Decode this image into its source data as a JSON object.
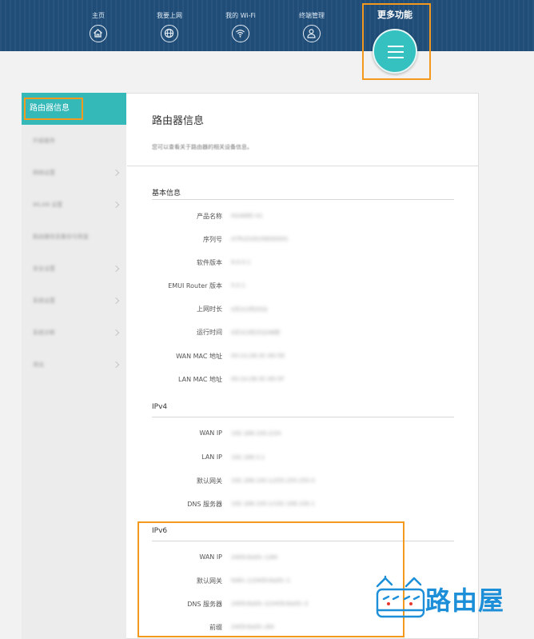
{
  "nav": {
    "items": [
      {
        "label": "主页",
        "icon": "home-icon"
      },
      {
        "label": "我要上网",
        "icon": "globe-icon"
      },
      {
        "label": "我的 Wi-Fi",
        "icon": "wifi-icon"
      },
      {
        "label": "终端管理",
        "icon": "user-icon"
      }
    ],
    "more_label": "更多功能",
    "more_icon": "menu-icon"
  },
  "sidebar": {
    "active": "路由器信息",
    "items": [
      "升级服务",
      "网络设置",
      "WLAN 设置",
      "路由器信息备份与恢复",
      "安全设置",
      "系统设置",
      "系统诊断",
      "退出"
    ]
  },
  "main": {
    "title": "路由器信息",
    "description": "您可以查看关于路由器的相关设备信息。",
    "sections": [
      {
        "title": "基本信息",
        "rows": [
          {
            "label": "产品名称",
            "value": "HUAWEI A1"
          },
          {
            "label": "序列号",
            "value": "A7PLD18109000001"
          },
          {
            "label": "软件版本",
            "value": "9.0.0.1"
          },
          {
            "label": "EMUI Router 版本",
            "value": "5.0.1"
          },
          {
            "label": "上网时长",
            "value": "0天3小时20分"
          },
          {
            "label": "运行时间",
            "value": "0天3小时25分46秒"
          },
          {
            "label": "WAN MAC 地址",
            "value": "00:1A:2B:3C:4D:5E"
          },
          {
            "label": "LAN MAC 地址",
            "value": "00:1A:2B:3C:4D:5F"
          }
        ]
      },
      {
        "title": "IPv4",
        "rows": [
          {
            "label": "WAN IP",
            "value": "192.168.100.2/24"
          },
          {
            "label": "LAN IP",
            "value": "192.168.3.1"
          },
          {
            "label": "默认网关",
            "value": "192.168.100.1/255.255.255.0"
          },
          {
            "label": "DNS 服务器",
            "value": "192.168.100.1/192.168.100.1"
          }
        ]
      },
      {
        "title": "IPv6",
        "rows": [
          {
            "label": "WAN IP",
            "value": "2409:8a00::1/64"
          },
          {
            "label": "默认网关",
            "value": "fe80::1/2409:8a00::1"
          },
          {
            "label": "DNS 服务器",
            "value": "2409:8a00::2/2409:8a00::3"
          },
          {
            "label": "前缀",
            "value": "2409:8a00::/64"
          }
        ]
      }
    ]
  },
  "logo": {
    "text": "路由屋"
  },
  "colors": {
    "header": "#1f4d78",
    "accent": "#35b8b8",
    "highlight": "#f39a1e",
    "logo": "#1c8fd8"
  }
}
